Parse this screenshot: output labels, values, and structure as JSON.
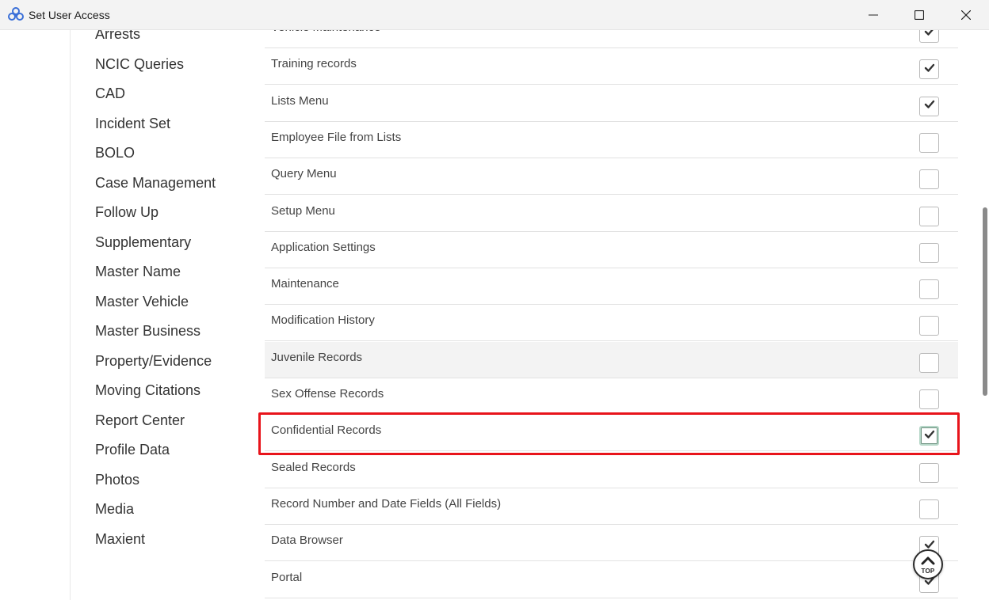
{
  "window": {
    "title": "Set User Access",
    "icons": {
      "app": "flower-logo-icon",
      "minimize": "minimize-icon",
      "maximize": "maximize-icon",
      "close": "close-icon"
    }
  },
  "nav": {
    "items": [
      "Arrests",
      "NCIC Queries",
      "CAD",
      "Incident Set",
      "BOLO",
      "Case Management",
      "Follow Up",
      "Supplementary",
      "Master Name",
      "Master Vehicle",
      "Master Business",
      "Property/Evidence",
      "Moving Citations",
      "Report Center",
      "Profile Data",
      "Photos",
      "Media",
      "Maxient"
    ]
  },
  "permissions": [
    {
      "label": "Vehicle Maintenance",
      "checked": true
    },
    {
      "label": "Training records",
      "checked": true
    },
    {
      "label": "Lists Menu",
      "checked": true
    },
    {
      "label": "Employee File from Lists",
      "checked": false
    },
    {
      "label": "Query Menu",
      "checked": false
    },
    {
      "label": "Setup Menu",
      "checked": false
    },
    {
      "label": "Application Settings",
      "checked": false
    },
    {
      "label": "Maintenance",
      "checked": false
    },
    {
      "label": "Modification History",
      "checked": false
    },
    {
      "label": "Juvenile Records",
      "checked": false,
      "hovered": true
    },
    {
      "label": "Sex Offense Records",
      "checked": false
    },
    {
      "label": "Confidential Records",
      "checked": true,
      "focused": true,
      "highlighted": true
    },
    {
      "label": "Sealed Records",
      "checked": false
    },
    {
      "label": "Record Number and Date Fields (All Fields)",
      "checked": false
    },
    {
      "label": "Data Browser",
      "checked": true
    },
    {
      "label": "Portal",
      "checked": true
    }
  ],
  "top_button": {
    "label": "TOP",
    "icon": "chevron-up-icon"
  },
  "colors": {
    "highlight": "#e8141b",
    "accent": "#3a6fd8",
    "check": "#333333"
  }
}
